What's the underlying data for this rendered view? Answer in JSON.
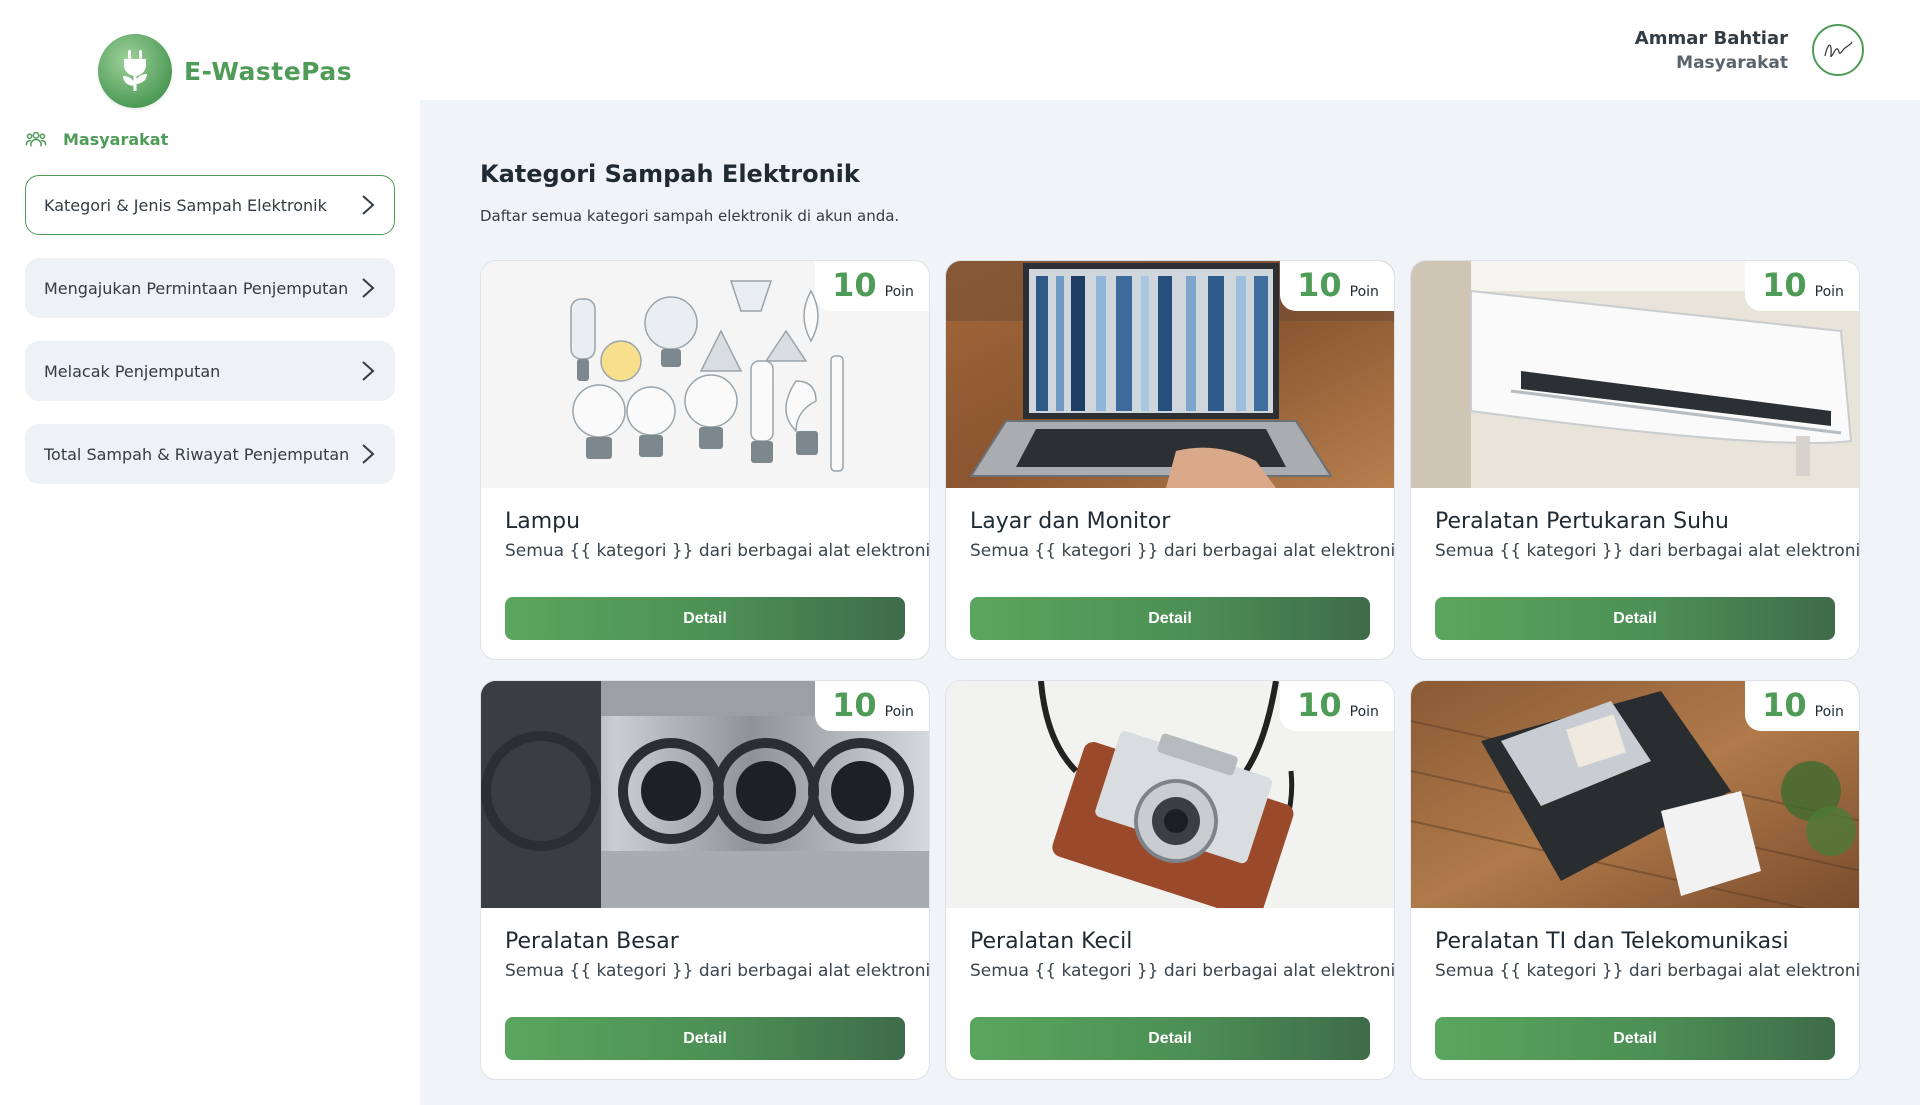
{
  "brand": {
    "name": "E-WastePas"
  },
  "sidebar": {
    "section": "Masyarakat",
    "items": [
      {
        "label": "Kategori & Jenis Sampah Elektronik",
        "active": true
      },
      {
        "label": "Mengajukan Permintaan Penjemputan",
        "active": false
      },
      {
        "label": "Melacak Penjemputan",
        "active": false
      },
      {
        "label": "Total Sampah & Riwayat Penjemputan",
        "active": false
      }
    ]
  },
  "user": {
    "name": "Ammar Bahtiar",
    "role": "Masyarakat"
  },
  "main": {
    "title": "Kategori Sampah Elektronik",
    "subtitle": "Daftar semua kategori sampah elektronik di akun anda."
  },
  "cards": [
    {
      "title": "Lampu",
      "desc": "Semua {{ kategori }} dari berbagai alat elektronik",
      "points": "10",
      "points_unit": "Poin",
      "button": "Detail"
    },
    {
      "title": "Layar dan Monitor",
      "desc": "Semua {{ kategori }} dari berbagai alat elektronik",
      "points": "10",
      "points_unit": "Poin",
      "button": "Detail"
    },
    {
      "title": "Peralatan Pertukaran Suhu",
      "desc": "Semua {{ kategori }} dari berbagai alat elektronik",
      "points": "10",
      "points_unit": "Poin",
      "button": "Detail"
    },
    {
      "title": "Peralatan Besar",
      "desc": "Semua {{ kategori }} dari berbagai alat elektronik",
      "points": "10",
      "points_unit": "Poin",
      "button": "Detail"
    },
    {
      "title": "Peralatan Kecil",
      "desc": "Semua {{ kategori }} dari berbagai alat elektronik",
      "points": "10",
      "points_unit": "Poin",
      "button": "Detail"
    },
    {
      "title": "Peralatan TI dan Telekomunikasi",
      "desc": "Semua {{ kategori }} dari berbagai alat elektronik",
      "points": "10",
      "points_unit": "Poin",
      "button": "Detail"
    }
  ],
  "colors": {
    "accent": "#4f9c58",
    "background": "#f0f3f7"
  }
}
